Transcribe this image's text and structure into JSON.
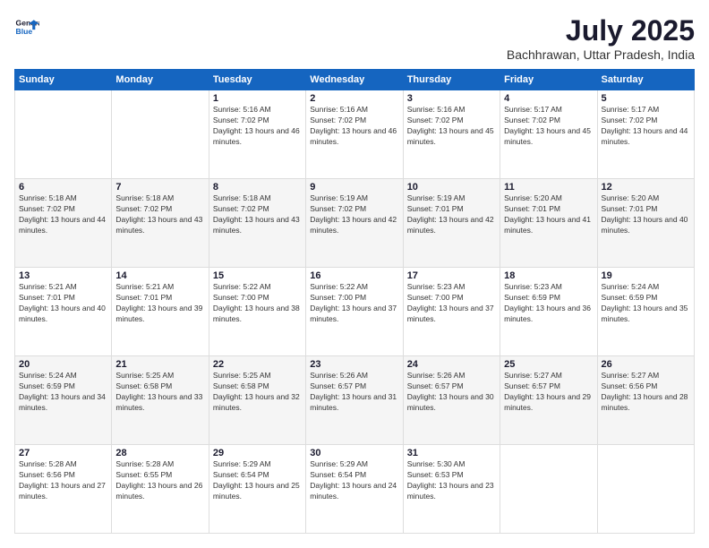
{
  "header": {
    "logo_line1": "General",
    "logo_line2": "Blue",
    "title": "July 2025",
    "subtitle": "Bachhrawan, Uttar Pradesh, India"
  },
  "calendar": {
    "days_of_week": [
      "Sunday",
      "Monday",
      "Tuesday",
      "Wednesday",
      "Thursday",
      "Friday",
      "Saturday"
    ],
    "weeks": [
      [
        {
          "day": "",
          "info": ""
        },
        {
          "day": "",
          "info": ""
        },
        {
          "day": "1",
          "info": "Sunrise: 5:16 AM\nSunset: 7:02 PM\nDaylight: 13 hours and 46 minutes."
        },
        {
          "day": "2",
          "info": "Sunrise: 5:16 AM\nSunset: 7:02 PM\nDaylight: 13 hours and 46 minutes."
        },
        {
          "day": "3",
          "info": "Sunrise: 5:16 AM\nSunset: 7:02 PM\nDaylight: 13 hours and 45 minutes."
        },
        {
          "day": "4",
          "info": "Sunrise: 5:17 AM\nSunset: 7:02 PM\nDaylight: 13 hours and 45 minutes."
        },
        {
          "day": "5",
          "info": "Sunrise: 5:17 AM\nSunset: 7:02 PM\nDaylight: 13 hours and 44 minutes."
        }
      ],
      [
        {
          "day": "6",
          "info": "Sunrise: 5:18 AM\nSunset: 7:02 PM\nDaylight: 13 hours and 44 minutes."
        },
        {
          "day": "7",
          "info": "Sunrise: 5:18 AM\nSunset: 7:02 PM\nDaylight: 13 hours and 43 minutes."
        },
        {
          "day": "8",
          "info": "Sunrise: 5:18 AM\nSunset: 7:02 PM\nDaylight: 13 hours and 43 minutes."
        },
        {
          "day": "9",
          "info": "Sunrise: 5:19 AM\nSunset: 7:02 PM\nDaylight: 13 hours and 42 minutes."
        },
        {
          "day": "10",
          "info": "Sunrise: 5:19 AM\nSunset: 7:01 PM\nDaylight: 13 hours and 42 minutes."
        },
        {
          "day": "11",
          "info": "Sunrise: 5:20 AM\nSunset: 7:01 PM\nDaylight: 13 hours and 41 minutes."
        },
        {
          "day": "12",
          "info": "Sunrise: 5:20 AM\nSunset: 7:01 PM\nDaylight: 13 hours and 40 minutes."
        }
      ],
      [
        {
          "day": "13",
          "info": "Sunrise: 5:21 AM\nSunset: 7:01 PM\nDaylight: 13 hours and 40 minutes."
        },
        {
          "day": "14",
          "info": "Sunrise: 5:21 AM\nSunset: 7:01 PM\nDaylight: 13 hours and 39 minutes."
        },
        {
          "day": "15",
          "info": "Sunrise: 5:22 AM\nSunset: 7:00 PM\nDaylight: 13 hours and 38 minutes."
        },
        {
          "day": "16",
          "info": "Sunrise: 5:22 AM\nSunset: 7:00 PM\nDaylight: 13 hours and 37 minutes."
        },
        {
          "day": "17",
          "info": "Sunrise: 5:23 AM\nSunset: 7:00 PM\nDaylight: 13 hours and 37 minutes."
        },
        {
          "day": "18",
          "info": "Sunrise: 5:23 AM\nSunset: 6:59 PM\nDaylight: 13 hours and 36 minutes."
        },
        {
          "day": "19",
          "info": "Sunrise: 5:24 AM\nSunset: 6:59 PM\nDaylight: 13 hours and 35 minutes."
        }
      ],
      [
        {
          "day": "20",
          "info": "Sunrise: 5:24 AM\nSunset: 6:59 PM\nDaylight: 13 hours and 34 minutes."
        },
        {
          "day": "21",
          "info": "Sunrise: 5:25 AM\nSunset: 6:58 PM\nDaylight: 13 hours and 33 minutes."
        },
        {
          "day": "22",
          "info": "Sunrise: 5:25 AM\nSunset: 6:58 PM\nDaylight: 13 hours and 32 minutes."
        },
        {
          "day": "23",
          "info": "Sunrise: 5:26 AM\nSunset: 6:57 PM\nDaylight: 13 hours and 31 minutes."
        },
        {
          "day": "24",
          "info": "Sunrise: 5:26 AM\nSunset: 6:57 PM\nDaylight: 13 hours and 30 minutes."
        },
        {
          "day": "25",
          "info": "Sunrise: 5:27 AM\nSunset: 6:57 PM\nDaylight: 13 hours and 29 minutes."
        },
        {
          "day": "26",
          "info": "Sunrise: 5:27 AM\nSunset: 6:56 PM\nDaylight: 13 hours and 28 minutes."
        }
      ],
      [
        {
          "day": "27",
          "info": "Sunrise: 5:28 AM\nSunset: 6:56 PM\nDaylight: 13 hours and 27 minutes."
        },
        {
          "day": "28",
          "info": "Sunrise: 5:28 AM\nSunset: 6:55 PM\nDaylight: 13 hours and 26 minutes."
        },
        {
          "day": "29",
          "info": "Sunrise: 5:29 AM\nSunset: 6:54 PM\nDaylight: 13 hours and 25 minutes."
        },
        {
          "day": "30",
          "info": "Sunrise: 5:29 AM\nSunset: 6:54 PM\nDaylight: 13 hours and 24 minutes."
        },
        {
          "day": "31",
          "info": "Sunrise: 5:30 AM\nSunset: 6:53 PM\nDaylight: 13 hours and 23 minutes."
        },
        {
          "day": "",
          "info": ""
        },
        {
          "day": "",
          "info": ""
        }
      ]
    ]
  }
}
